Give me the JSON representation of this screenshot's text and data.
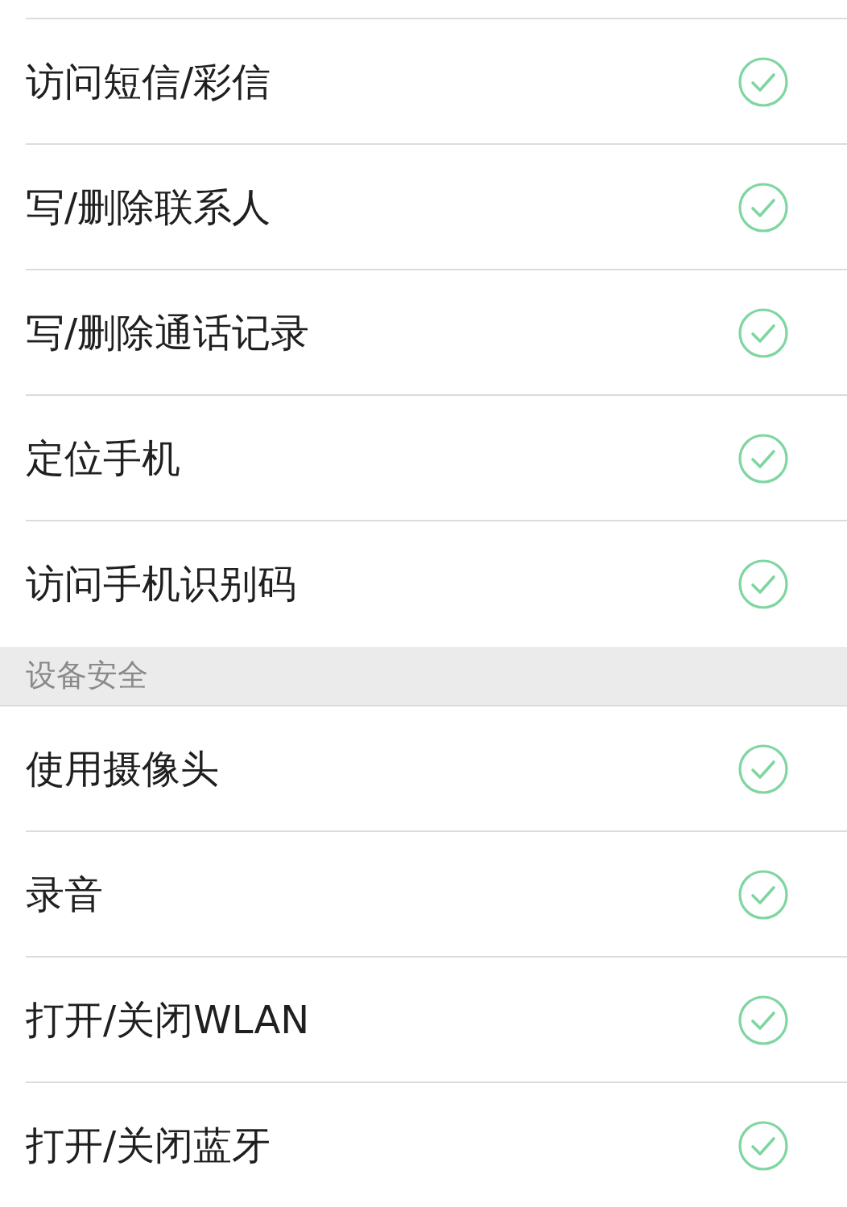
{
  "groups": [
    {
      "items": [
        {
          "label": "访问短信/彩信",
          "checked": true
        },
        {
          "label": "写/删除联系人",
          "checked": true
        },
        {
          "label": "写/删除通话记录",
          "checked": true
        },
        {
          "label": "定位手机",
          "checked": true
        },
        {
          "label": "访问手机识别码",
          "checked": true
        }
      ]
    },
    {
      "title": "设备安全",
      "items": [
        {
          "label": "使用摄像头",
          "checked": true
        },
        {
          "label": "录音",
          "checked": true
        },
        {
          "label": "打开/关闭WLAN",
          "checked": true
        },
        {
          "label": "打开/关闭蓝牙",
          "checked": true
        }
      ]
    }
  ]
}
